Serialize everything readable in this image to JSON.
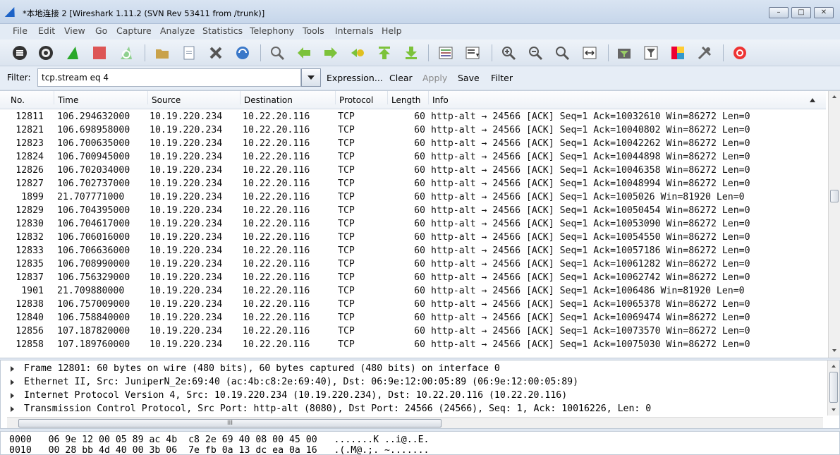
{
  "window": {
    "title": "*本地连接 2  [Wireshark 1.11.2  (SVN Rev 53411 from /trunk)]",
    "minimize_label": "–",
    "maximize_label": "□",
    "close_label": "✕"
  },
  "menu": [
    "File",
    "Edit",
    "View",
    "Go",
    "Capture",
    "Analyze",
    "Statistics",
    "Telephony",
    "Tools",
    "Internals",
    "Help"
  ],
  "toolbar": {
    "icons": [
      "interface-list-icon",
      "capture-options-icon",
      "start-capture-icon",
      "stop-capture-icon",
      "restart-capture-icon",
      "open-file-icon",
      "save-file-icon",
      "close-file-icon",
      "reload-icon",
      "find-packet-icon",
      "go-back-icon",
      "go-forward-icon",
      "go-to-packet-icon",
      "go-first-icon",
      "go-last-icon",
      "colorize-icon",
      "auto-scroll-icon",
      "zoom-in-icon",
      "zoom-out-icon",
      "normal-size-icon",
      "resize-columns-icon",
      "capture-filters-icon",
      "display-filters-icon",
      "coloring-rules-icon",
      "preferences-icon",
      "help-icon"
    ]
  },
  "filter": {
    "label": "Filter:",
    "value": "tcp.stream eq 4",
    "buttons": [
      "Expression...",
      "Clear",
      "Apply",
      "Save",
      "Filter"
    ]
  },
  "packet_list": {
    "columns": [
      "No.",
      "Time",
      "Source",
      "Destination",
      "Protocol",
      "Length",
      "Info"
    ],
    "rows": [
      {
        "no": "12811",
        "time": "106.294632000",
        "src": "10.19.220.234",
        "dst": "10.22.20.116",
        "proto": "TCP",
        "len": "60",
        "info": "http-alt → 24566 [ACK] Seq=1 Ack=10032610 Win=86272 Len=0"
      },
      {
        "no": "12821",
        "time": "106.698958000",
        "src": "10.19.220.234",
        "dst": "10.22.20.116",
        "proto": "TCP",
        "len": "60",
        "info": "http-alt → 24566 [ACK] Seq=1 Ack=10040802 Win=86272 Len=0"
      },
      {
        "no": "12823",
        "time": "106.700635000",
        "src": "10.19.220.234",
        "dst": "10.22.20.116",
        "proto": "TCP",
        "len": "60",
        "info": "http-alt → 24566 [ACK] Seq=1 Ack=10042262 Win=86272 Len=0"
      },
      {
        "no": "12824",
        "time": "106.700945000",
        "src": "10.19.220.234",
        "dst": "10.22.20.116",
        "proto": "TCP",
        "len": "60",
        "info": "http-alt → 24566 [ACK] Seq=1 Ack=10044898 Win=86272 Len=0"
      },
      {
        "no": "12826",
        "time": "106.702034000",
        "src": "10.19.220.234",
        "dst": "10.22.20.116",
        "proto": "TCP",
        "len": "60",
        "info": "http-alt → 24566 [ACK] Seq=1 Ack=10046358 Win=86272 Len=0"
      },
      {
        "no": "12827",
        "time": "106.702737000",
        "src": "10.19.220.234",
        "dst": "10.22.20.116",
        "proto": "TCP",
        "len": "60",
        "info": "http-alt → 24566 [ACK] Seq=1 Ack=10048994 Win=86272 Len=0"
      },
      {
        "no": "1899",
        "time": "21.707771000",
        "src": "10.19.220.234",
        "dst": "10.22.20.116",
        "proto": "TCP",
        "len": "60",
        "info": "http-alt → 24566 [ACK] Seq=1 Ack=1005026 Win=81920 Len=0"
      },
      {
        "no": "12829",
        "time": "106.704395000",
        "src": "10.19.220.234",
        "dst": "10.22.20.116",
        "proto": "TCP",
        "len": "60",
        "info": "http-alt → 24566 [ACK] Seq=1 Ack=10050454 Win=86272 Len=0"
      },
      {
        "no": "12830",
        "time": "106.704617000",
        "src": "10.19.220.234",
        "dst": "10.22.20.116",
        "proto": "TCP",
        "len": "60",
        "info": "http-alt → 24566 [ACK] Seq=1 Ack=10053090 Win=86272 Len=0"
      },
      {
        "no": "12832",
        "time": "106.706016000",
        "src": "10.19.220.234",
        "dst": "10.22.20.116",
        "proto": "TCP",
        "len": "60",
        "info": "http-alt → 24566 [ACK] Seq=1 Ack=10054550 Win=86272 Len=0"
      },
      {
        "no": "12833",
        "time": "106.706636000",
        "src": "10.19.220.234",
        "dst": "10.22.20.116",
        "proto": "TCP",
        "len": "60",
        "info": "http-alt → 24566 [ACK] Seq=1 Ack=10057186 Win=86272 Len=0"
      },
      {
        "no": "12835",
        "time": "106.708990000",
        "src": "10.19.220.234",
        "dst": "10.22.20.116",
        "proto": "TCP",
        "len": "60",
        "info": "http-alt → 24566 [ACK] Seq=1 Ack=10061282 Win=86272 Len=0"
      },
      {
        "no": "12837",
        "time": "106.756329000",
        "src": "10.19.220.234",
        "dst": "10.22.20.116",
        "proto": "TCP",
        "len": "60",
        "info": "http-alt → 24566 [ACK] Seq=1 Ack=10062742 Win=86272 Len=0"
      },
      {
        "no": "1901",
        "time": "21.709880000",
        "src": "10.19.220.234",
        "dst": "10.22.20.116",
        "proto": "TCP",
        "len": "60",
        "info": "http-alt → 24566 [ACK] Seq=1 Ack=1006486 Win=81920 Len=0"
      },
      {
        "no": "12838",
        "time": "106.757009000",
        "src": "10.19.220.234",
        "dst": "10.22.20.116",
        "proto": "TCP",
        "len": "60",
        "info": "http-alt → 24566 [ACK] Seq=1 Ack=10065378 Win=86272 Len=0"
      },
      {
        "no": "12840",
        "time": "106.758840000",
        "src": "10.19.220.234",
        "dst": "10.22.20.116",
        "proto": "TCP",
        "len": "60",
        "info": "http-alt → 24566 [ACK] Seq=1 Ack=10069474 Win=86272 Len=0"
      },
      {
        "no": "12856",
        "time": "107.187820000",
        "src": "10.19.220.234",
        "dst": "10.22.20.116",
        "proto": "TCP",
        "len": "60",
        "info": "http-alt → 24566 [ACK] Seq=1 Ack=10073570 Win=86272 Len=0"
      },
      {
        "no": "12858",
        "time": "107.189760000",
        "src": "10.19.220.234",
        "dst": "10.22.20.116",
        "proto": "TCP",
        "len": "60",
        "info": "http-alt → 24566 [ACK] Seq=1 Ack=10075030 Win=86272 Len=0"
      }
    ]
  },
  "details": [
    "Frame 12801: 60 bytes on wire (480 bits), 60 bytes captured (480 bits) on interface 0",
    "Ethernet II, Src: JuniperN_2e:69:40 (ac:4b:c8:2e:69:40), Dst: 06:9e:12:00:05:89 (06:9e:12:00:05:89)",
    "Internet Protocol Version 4, Src: 10.19.220.234 (10.19.220.234), Dst: 10.22.20.116 (10.22.20.116)",
    "Transmission Control Protocol, Src Port: http-alt (8080), Dst Port: 24566 (24566), Seq: 1, Ack: 10016226, Len: 0"
  ],
  "hscroll_grip": "III",
  "bytes": [
    "0000   06 9e 12 00 05 89 ac 4b  c8 2e 69 40 08 00 45 00   .......K ..i@..E.",
    "0010   00 28 bb 4d 40 00 3b 06  7e fb 0a 13 dc ea 0a 16   .(.M@.;. ~......."
  ],
  "colors": {
    "accent": "#1d63c7",
    "window": "#dfe7f1"
  }
}
